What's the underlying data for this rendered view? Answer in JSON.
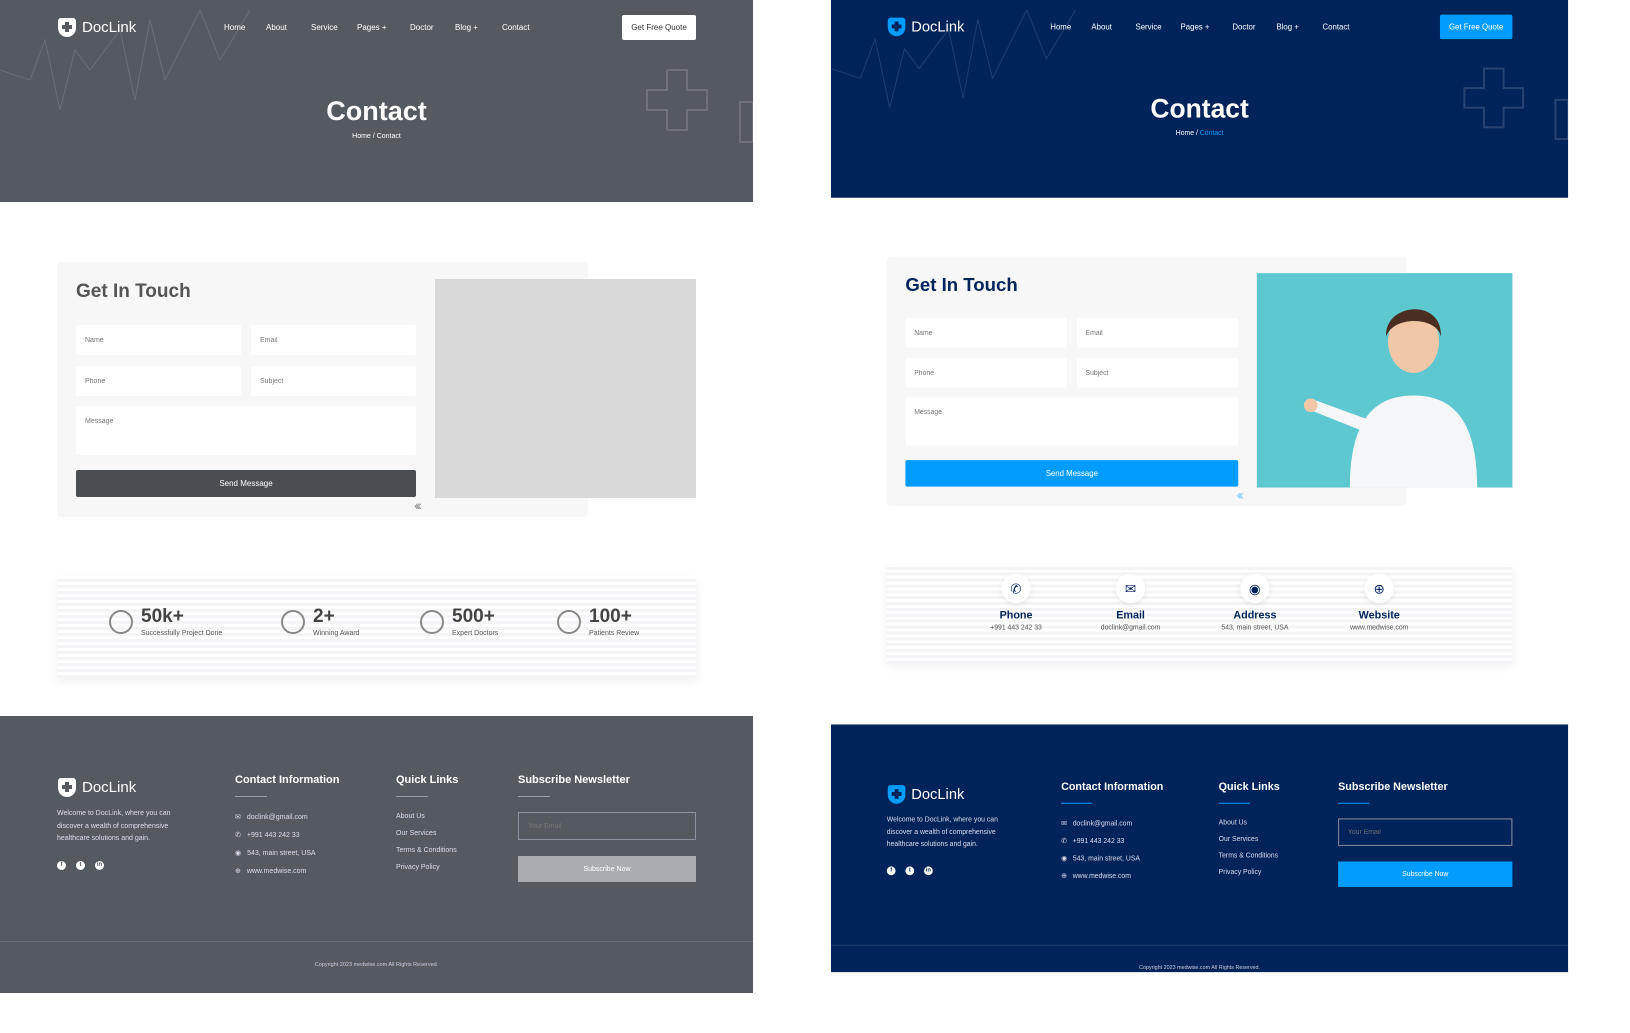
{
  "brand": "DocLink",
  "nav": {
    "items": [
      "Home",
      "About",
      "Service",
      "Pages +",
      "Doctor",
      "Blog +",
      "Contact"
    ],
    "cta": "Get Free Quote"
  },
  "hero": {
    "title": "Contact",
    "breadcrumb_home": "Home",
    "breadcrumb_sep": "/",
    "breadcrumb_current": "Contact"
  },
  "form": {
    "title": "Get In Touch",
    "name_placeholder": "Name",
    "email_placeholder": "Email",
    "phone_placeholder": "Phone",
    "subject_placeholder": "Subject",
    "message_placeholder": "Message",
    "submit": "Send Message"
  },
  "stats": [
    {
      "value": "50k+",
      "label": "Successfully Project Done",
      "icon": "gear-brain-icon"
    },
    {
      "value": "2+",
      "label": "Winning Award",
      "icon": "trophy-icon"
    },
    {
      "value": "500+",
      "label": "Expert Doctors",
      "icon": "doctor-icon"
    },
    {
      "value": "100+",
      "label": "Patients Review",
      "icon": "review-icon"
    }
  ],
  "contact_cards": [
    {
      "title": "Phone",
      "value": "+991 443 242 33",
      "icon": "phone-icon"
    },
    {
      "title": "Email",
      "value": "doclink@gmail.com",
      "icon": "envelope-icon"
    },
    {
      "title": "Address",
      "value": "543, main street, USA",
      "icon": "map-pin-icon"
    },
    {
      "title": "Website",
      "value": "www.medwise.com",
      "icon": "globe-icon"
    }
  ],
  "footer": {
    "about": "Welcome to DocLink, where you can discover a wealth of comprehensive healthcare solutions and gain.",
    "contact_heading": "Contact Information",
    "contact": [
      "doclink@gmail.com",
      "+991 443 242 33",
      "543, main street, USA",
      "www.medwise.com"
    ],
    "links_heading": "Quick Links",
    "links": [
      "About Us",
      "Our Services",
      "Terms & Conditions",
      "Privacy Policy"
    ],
    "newsletter_heading": "Subscribe Newsletter",
    "email_placeholder": "Your Email",
    "subscribe": "Subscribe Now",
    "copyright": "Copyright 2023 medwise.com All Rights Reserved."
  },
  "colors": {
    "wire_bg": "#555a61",
    "navy": "#00235a",
    "accent": "#009cff"
  }
}
